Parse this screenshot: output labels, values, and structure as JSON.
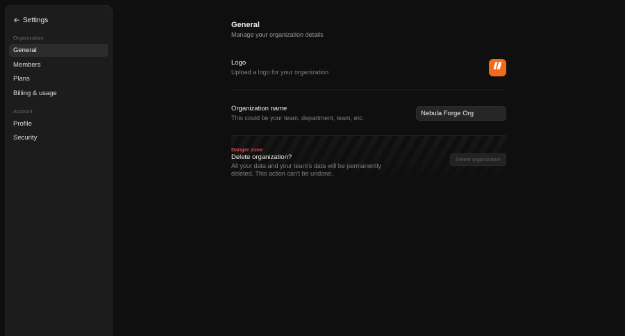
{
  "sidebar": {
    "back_label": "Settings",
    "sections": [
      {
        "label": "Organization",
        "items": [
          {
            "label": "General",
            "active": true
          },
          {
            "label": "Members",
            "active": false
          },
          {
            "label": "Plans",
            "active": false
          },
          {
            "label": "Billing & usage",
            "active": false
          }
        ]
      },
      {
        "label": "Account",
        "items": [
          {
            "label": "Profile",
            "active": false
          },
          {
            "label": "Security",
            "active": false
          }
        ]
      }
    ]
  },
  "main": {
    "title": "General",
    "subtitle": "Manage your organization details",
    "logo": {
      "title": "Logo",
      "description": "Upload a logo for your organization",
      "color": "#f26b1d"
    },
    "org_name": {
      "title": "Organization name",
      "description": "This could be your team, department, team, etc.",
      "value": "Nebula Forge Org"
    },
    "danger_zone": {
      "label": "Danger zone",
      "title": "Delete organization?",
      "description": "All your data and your team's data will be permanently deleted. This action can't be undone.",
      "button_label": "Delete organization"
    }
  },
  "colors": {
    "background": "#0f0f0f",
    "sidebar": "#1c1c1c",
    "accent": "#f26b1d",
    "danger": "#e5484d"
  },
  "icons": {
    "back": "arrow-left-icon",
    "logo": "org-logo-icon"
  }
}
